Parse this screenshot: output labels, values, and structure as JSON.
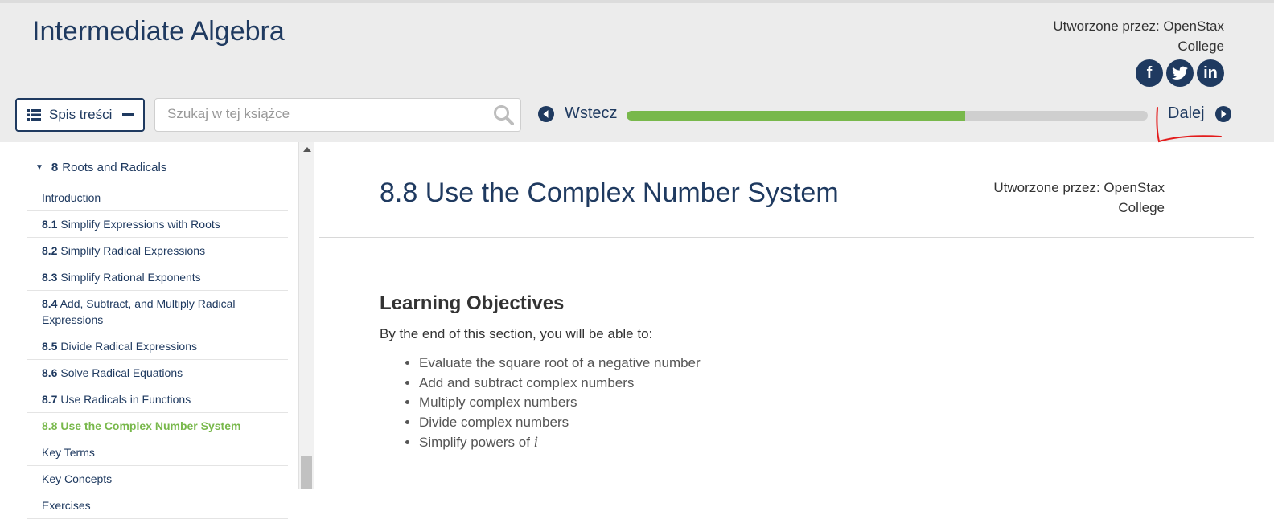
{
  "header": {
    "book_title": "Intermediate Algebra",
    "author_line1": "Utworzone przez: OpenStax",
    "author_line2": "College",
    "social": [
      {
        "icon": "facebook-icon",
        "glyph": "f"
      },
      {
        "icon": "twitter-icon",
        "glyph": "t"
      },
      {
        "icon": "linkedin-icon",
        "glyph": "in"
      }
    ]
  },
  "toolbar": {
    "toc_label": "Spis treści",
    "search_placeholder": "Szukaj w tej książce",
    "back_label": "Wstecz",
    "next_label": "Dalej",
    "progress": 0.65
  },
  "sidebar": {
    "chapter_number": "8",
    "chapter_title": "Roots and Radicals",
    "items": [
      {
        "num": "",
        "label": "Introduction",
        "active": false
      },
      {
        "num": "8.1",
        "label": "Simplify Expressions with Roots",
        "active": false
      },
      {
        "num": "8.2",
        "label": "Simplify Radical Expressions",
        "active": false
      },
      {
        "num": "8.3",
        "label": "Simplify Rational Exponents",
        "active": false
      },
      {
        "num": "8.4",
        "label": "Add, Subtract, and Multiply Radical Expressions",
        "active": false
      },
      {
        "num": "8.5",
        "label": "Divide Radical Expressions",
        "active": false
      },
      {
        "num": "8.6",
        "label": "Solve Radical Equations",
        "active": false
      },
      {
        "num": "8.7",
        "label": "Use Radicals in Functions",
        "active": false
      },
      {
        "num": "8.8",
        "label": "Use the Complex Number System",
        "active": true
      },
      {
        "num": "",
        "label": "Key Terms",
        "active": false
      },
      {
        "num": "",
        "label": "Key Concepts",
        "active": false
      },
      {
        "num": "",
        "label": "Exercises",
        "active": false
      }
    ]
  },
  "content": {
    "title": "8.8 Use the Complex Number System",
    "author_line1": "Utworzone przez: OpenStax",
    "author_line2": "College",
    "objectives_heading": "Learning Objectives",
    "objectives_intro": "By the end of this section, you will be able to:",
    "objectives": [
      "Evaluate the square root of a negative number",
      "Add and subtract complex numbers",
      "Multiply complex numbers",
      "Divide complex numbers",
      "Simplify powers of "
    ],
    "objective_last_var": "i"
  },
  "colors": {
    "navy": "#1f3a60",
    "green": "#78b84b",
    "annotation_red": "#e31b1b"
  }
}
